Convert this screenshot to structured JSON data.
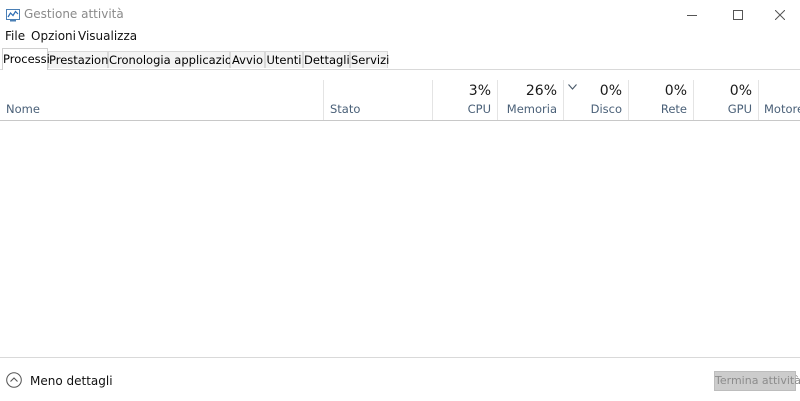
{
  "window": {
    "title": "Gestione attività"
  },
  "menu": {
    "items": [
      "File",
      "Opzioni",
      "Visualizza"
    ]
  },
  "tabs": [
    {
      "label": "Processi",
      "active": true
    },
    {
      "label": "Prestazioni",
      "active": false
    },
    {
      "label": "Cronologia applicazioni",
      "active": false
    },
    {
      "label": "Avvio",
      "active": false
    },
    {
      "label": "Utenti",
      "active": false
    },
    {
      "label": "Dettagli",
      "active": false
    },
    {
      "label": "Servizi",
      "active": false
    }
  ],
  "columns": {
    "name": {
      "label": "Nome"
    },
    "status": {
      "label": "Stato"
    },
    "cpu": {
      "label": "CPU",
      "value": "3%"
    },
    "memory": {
      "label": "Memoria",
      "value": "26%"
    },
    "disk": {
      "label": "Disco",
      "value": "0%"
    },
    "network": {
      "label": "Rete",
      "value": "0%"
    },
    "gpu": {
      "label": "GPU",
      "value": "0%"
    },
    "engine": {
      "label": "Motore"
    }
  },
  "footer": {
    "less_details": "Meno dettagli",
    "end_task": "Termina attività"
  },
  "colors": {
    "header_label": "#4a6078",
    "disabled_button_bg": "#cccccc",
    "disabled_button_text": "#8c8c8c",
    "title_text": "#8a8a8a"
  },
  "icons": {
    "app": "task-manager-icon",
    "minimize": "minimize-icon",
    "maximize": "maximize-icon",
    "close": "close-icon",
    "sort": "chevron-down-icon",
    "less_details": "chevron-up-circle-icon"
  }
}
